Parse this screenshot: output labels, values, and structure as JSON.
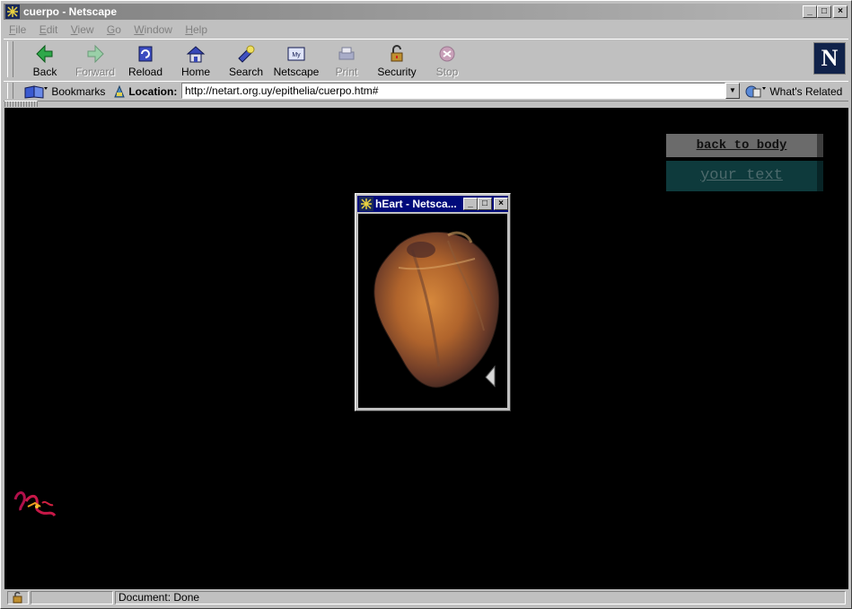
{
  "window": {
    "title": "cuerpo - Netscape"
  },
  "menu": [
    {
      "label": "File",
      "key": "F",
      "rest": "ile"
    },
    {
      "label": "Edit",
      "key": "E",
      "rest": "dit"
    },
    {
      "label": "View",
      "key": "V",
      "rest": "iew"
    },
    {
      "label": "Go",
      "key": "G",
      "rest": "o"
    },
    {
      "label": "Window",
      "key": "W",
      "rest": "indow"
    },
    {
      "label": "Help",
      "key": "H",
      "rest": "elp"
    }
  ],
  "toolbar": {
    "back": "Back",
    "forward": "Forward",
    "reload": "Reload",
    "home": "Home",
    "search": "Search",
    "netscape": "Netscape",
    "print": "Print",
    "security": "Security",
    "stop": "Stop"
  },
  "location": {
    "bookmarks": "Bookmarks",
    "label": "Location:",
    "url": "http://netart.org.uy/epithelia/cuerpo.htm#",
    "whats_related": "What's Related"
  },
  "page": {
    "back_to_body": "back to body",
    "your_text": "your text"
  },
  "popup": {
    "title": "hEart - Netsca..."
  },
  "status": {
    "text": "Document: Done"
  },
  "colors": {
    "title_bar": "#808080",
    "popup_title": "#000a7a",
    "content_bg": "#000000"
  }
}
